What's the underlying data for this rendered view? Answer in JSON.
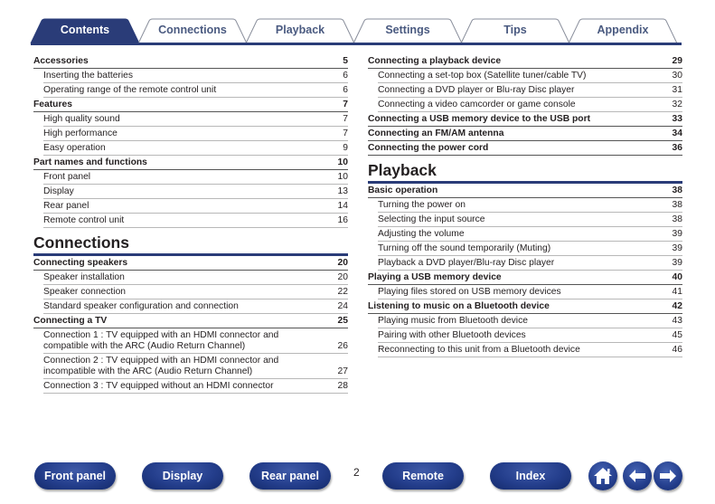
{
  "tabs": [
    {
      "label": "Contents",
      "active": true
    },
    {
      "label": "Connections",
      "active": false
    },
    {
      "label": "Playback",
      "active": false
    },
    {
      "label": "Settings",
      "active": false
    },
    {
      "label": "Tips",
      "active": false
    },
    {
      "label": "Appendix",
      "active": false
    }
  ],
  "colors": {
    "accent": "#2a3c78",
    "tab_inactive_text": "#4a5a80",
    "button": "#243e8c"
  },
  "left_column": {
    "groups": [
      {
        "title": "Accessories",
        "page": "5",
        "items": [
          {
            "title": "Inserting the batteries",
            "page": "6"
          },
          {
            "title": "Operating range of the remote control unit",
            "page": "6"
          }
        ]
      },
      {
        "title": "Features",
        "page": "7",
        "items": [
          {
            "title": "High quality sound",
            "page": "7"
          },
          {
            "title": "High performance",
            "page": "7"
          },
          {
            "title": "Easy operation",
            "page": "9"
          }
        ]
      },
      {
        "title": "Part names and functions",
        "page": "10",
        "items": [
          {
            "title": "Front panel",
            "page": "10"
          },
          {
            "title": "Display",
            "page": "13"
          },
          {
            "title": "Rear panel",
            "page": "14"
          },
          {
            "title": "Remote control unit",
            "page": "16"
          }
        ]
      }
    ],
    "section2_title": "Connections",
    "section2_groups": [
      {
        "title": "Connecting speakers",
        "page": "20",
        "items": [
          {
            "title": "Speaker installation",
            "page": "20"
          },
          {
            "title": "Speaker connection",
            "page": "22"
          },
          {
            "title": "Standard speaker configuration and connection",
            "page": "24"
          }
        ]
      },
      {
        "title": "Connecting a TV",
        "page": "25",
        "items": [
          {
            "title": "Connection 1 : TV equipped with an HDMI connector and\ncompatible with the ARC (Audio Return Channel)",
            "page": "26"
          },
          {
            "title": "Connection 2 : TV equipped with an HDMI connector and\nincompatible with the ARC (Audio Return Channel)",
            "page": "27"
          },
          {
            "title": "Connection 3 : TV equipped without an HDMI connector",
            "page": "28"
          }
        ]
      }
    ]
  },
  "right_column": {
    "groups": [
      {
        "title": "Connecting a playback device",
        "page": "29",
        "items": [
          {
            "title": "Connecting a set-top box (Satellite tuner/cable TV)",
            "page": "30"
          },
          {
            "title": "Connecting a DVD player or Blu-ray Disc player",
            "page": "31"
          },
          {
            "title": "Connecting a video camcorder or game console",
            "page": "32"
          }
        ]
      },
      {
        "title": "Connecting a USB memory device to the USB port",
        "page": "33",
        "items": []
      },
      {
        "title": "Connecting an FM/AM antenna",
        "page": "34",
        "items": []
      },
      {
        "title": "Connecting the power cord",
        "page": "36",
        "items": []
      }
    ],
    "section2_title": "Playback",
    "section2_groups": [
      {
        "title": "Basic operation",
        "page": "38",
        "items": [
          {
            "title": "Turning the power on",
            "page": "38"
          },
          {
            "title": "Selecting the input source",
            "page": "38"
          },
          {
            "title": "Adjusting the volume",
            "page": "39"
          },
          {
            "title": "Turning off the sound temporarily (Muting)",
            "page": "39"
          },
          {
            "title": "Playback a DVD player/Blu-ray Disc player",
            "page": "39"
          }
        ]
      },
      {
        "title": "Playing a USB memory device",
        "page": "40",
        "items": [
          {
            "title": "Playing files stored on USB memory devices",
            "page": "41"
          }
        ]
      },
      {
        "title": "Listening to music on a Bluetooth device",
        "page": "42",
        "items": [
          {
            "title": "Playing music from Bluetooth device",
            "page": "43"
          },
          {
            "title": "Pairing with other Bluetooth devices",
            "page": "45"
          },
          {
            "title": "Reconnecting to this unit from a Bluetooth device",
            "page": "46"
          }
        ]
      }
    ]
  },
  "footer": {
    "buttons": [
      "Front panel",
      "Display",
      "Rear panel",
      "Remote",
      "Index"
    ],
    "page_number": "2",
    "icons": [
      "home-icon",
      "back-arrow-icon",
      "forward-arrow-icon"
    ]
  }
}
